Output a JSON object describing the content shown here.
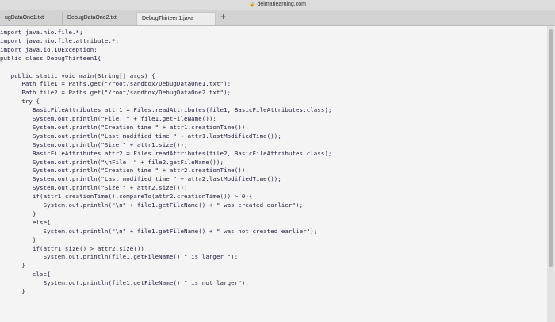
{
  "browser": {
    "url": "delmarlearning.com"
  },
  "tabs": [
    {
      "label": "ugDataOne1.txt"
    },
    {
      "label": "DebugDataOne2.txt"
    },
    {
      "label": "DebugThirteen1.java"
    }
  ],
  "tab_add_label": "+",
  "code_lines": [
    "import java.nio.file.*;",
    "import java.nio.file.attribute.*;",
    "import java.io.IOException;",
    "public class DebugThirteen1{",
    "",
    "   public static void main(String[] args) {",
    "      Path file1 = Paths.get(\"/root/sandbox/DebugDataOne1.txt\");",
    "      Path file2 = Paths.get(\"/root/sandbox/DebugDataOne2.txt\");",
    "      try {",
    "         BasicFileAttributes attr1 = Files.readAttributes(file1, BasicFileAttributes.class);",
    "         System.out.println(\"File: \" + file1.getFileName());",
    "         System.out.println(\"Creation time \" + attr1.creationTime());",
    "         System.out.println(\"Last modified time \" + attr1.lastModifiedTime());",
    "         System.out.println(\"Size \" + attr1.size());",
    "         BasicFileAttributes attr2 = Files.readAttributes(file2, BasicFileAttributes.class);",
    "         System.out.println(\"\\nFile: \" + file2.getFileName());",
    "         System.out.println(\"Creation time \" + attr2.creationTime());",
    "         System.out.println(\"Last modified time \" + attr2.lastModifiedTime());",
    "         System.out.println(\"Size \" + attr2.size());",
    "         if(attr1.creationTime().compareTo(attr2.creationTime()) > 0){",
    "            System.out.println(\"\\n\" + file1.getFileName() + \" was created earlier\");",
    "         }",
    "         else{",
    "            System.out.println(\"\\n\" + file1.getFileName() + \" was not created earlier\");",
    "         }",
    "         if(attr1.size() > attr2.size())",
    "            System.out.println(file1.getFileName() \" is larger \");",
    "      }",
    "         else{",
    "            System.out.println(file1.getFileName() \" is not larger\");",
    "      }"
  ]
}
